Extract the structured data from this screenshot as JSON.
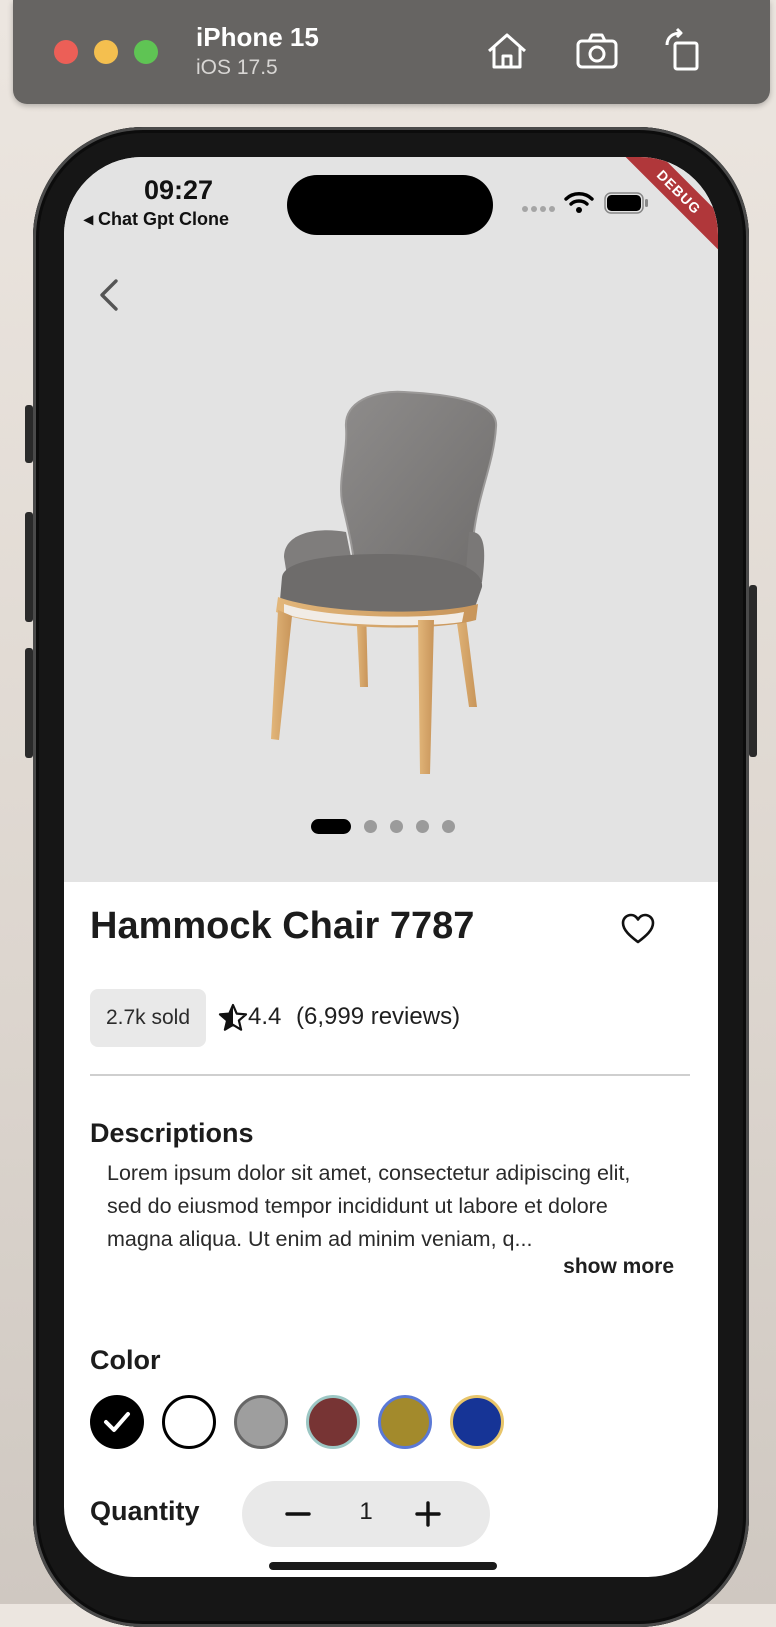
{
  "simulator": {
    "device_name": "iPhone 15",
    "os_version": "iOS 17.5",
    "home_icon": "home-icon",
    "screenshot_icon": "camera-icon",
    "rotate_icon": "rotate-icon"
  },
  "status_bar": {
    "time": "09:27",
    "back_app": "◂ Chat Gpt Clone",
    "debug_label": "DEBUG"
  },
  "product": {
    "name": "Hammock Chair 7787",
    "sold": "2.7k sold",
    "rating": "4.4",
    "reviews": "(6,999 reviews)",
    "image_count": 5,
    "active_image_index": 0,
    "description_heading": "Descriptions",
    "description": "Lorem ipsum dolor sit amet, consectetur adipiscing elit, sed do eiusmod tempor incididunt ut labore et dolore magna aliqua. Ut enim ad minim veniam, q...",
    "show_more": "show more",
    "color_heading": "Color",
    "colors": [
      "#000000",
      "#ffffff",
      "#9e9e9e",
      "#773434",
      "#a38a2c",
      "#163496"
    ],
    "selected_color_index": 0,
    "quantity_heading": "Quantity",
    "quantity": "1"
  }
}
